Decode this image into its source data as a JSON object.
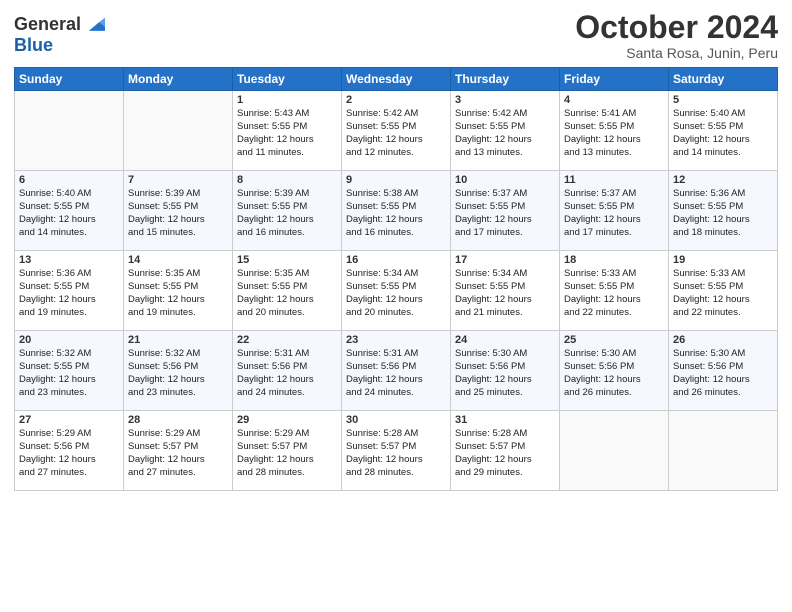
{
  "logo": {
    "line1": "General",
    "line2": "Blue"
  },
  "title": "October 2024",
  "location": "Santa Rosa, Junin, Peru",
  "days_header": [
    "Sunday",
    "Monday",
    "Tuesday",
    "Wednesday",
    "Thursday",
    "Friday",
    "Saturday"
  ],
  "weeks": [
    [
      {
        "num": "",
        "info": ""
      },
      {
        "num": "",
        "info": ""
      },
      {
        "num": "1",
        "info": "Sunrise: 5:43 AM\nSunset: 5:55 PM\nDaylight: 12 hours\nand 11 minutes."
      },
      {
        "num": "2",
        "info": "Sunrise: 5:42 AM\nSunset: 5:55 PM\nDaylight: 12 hours\nand 12 minutes."
      },
      {
        "num": "3",
        "info": "Sunrise: 5:42 AM\nSunset: 5:55 PM\nDaylight: 12 hours\nand 13 minutes."
      },
      {
        "num": "4",
        "info": "Sunrise: 5:41 AM\nSunset: 5:55 PM\nDaylight: 12 hours\nand 13 minutes."
      },
      {
        "num": "5",
        "info": "Sunrise: 5:40 AM\nSunset: 5:55 PM\nDaylight: 12 hours\nand 14 minutes."
      }
    ],
    [
      {
        "num": "6",
        "info": "Sunrise: 5:40 AM\nSunset: 5:55 PM\nDaylight: 12 hours\nand 14 minutes."
      },
      {
        "num": "7",
        "info": "Sunrise: 5:39 AM\nSunset: 5:55 PM\nDaylight: 12 hours\nand 15 minutes."
      },
      {
        "num": "8",
        "info": "Sunrise: 5:39 AM\nSunset: 5:55 PM\nDaylight: 12 hours\nand 16 minutes."
      },
      {
        "num": "9",
        "info": "Sunrise: 5:38 AM\nSunset: 5:55 PM\nDaylight: 12 hours\nand 16 minutes."
      },
      {
        "num": "10",
        "info": "Sunrise: 5:37 AM\nSunset: 5:55 PM\nDaylight: 12 hours\nand 17 minutes."
      },
      {
        "num": "11",
        "info": "Sunrise: 5:37 AM\nSunset: 5:55 PM\nDaylight: 12 hours\nand 17 minutes."
      },
      {
        "num": "12",
        "info": "Sunrise: 5:36 AM\nSunset: 5:55 PM\nDaylight: 12 hours\nand 18 minutes."
      }
    ],
    [
      {
        "num": "13",
        "info": "Sunrise: 5:36 AM\nSunset: 5:55 PM\nDaylight: 12 hours\nand 19 minutes."
      },
      {
        "num": "14",
        "info": "Sunrise: 5:35 AM\nSunset: 5:55 PM\nDaylight: 12 hours\nand 19 minutes."
      },
      {
        "num": "15",
        "info": "Sunrise: 5:35 AM\nSunset: 5:55 PM\nDaylight: 12 hours\nand 20 minutes."
      },
      {
        "num": "16",
        "info": "Sunrise: 5:34 AM\nSunset: 5:55 PM\nDaylight: 12 hours\nand 20 minutes."
      },
      {
        "num": "17",
        "info": "Sunrise: 5:34 AM\nSunset: 5:55 PM\nDaylight: 12 hours\nand 21 minutes."
      },
      {
        "num": "18",
        "info": "Sunrise: 5:33 AM\nSunset: 5:55 PM\nDaylight: 12 hours\nand 22 minutes."
      },
      {
        "num": "19",
        "info": "Sunrise: 5:33 AM\nSunset: 5:55 PM\nDaylight: 12 hours\nand 22 minutes."
      }
    ],
    [
      {
        "num": "20",
        "info": "Sunrise: 5:32 AM\nSunset: 5:55 PM\nDaylight: 12 hours\nand 23 minutes."
      },
      {
        "num": "21",
        "info": "Sunrise: 5:32 AM\nSunset: 5:56 PM\nDaylight: 12 hours\nand 23 minutes."
      },
      {
        "num": "22",
        "info": "Sunrise: 5:31 AM\nSunset: 5:56 PM\nDaylight: 12 hours\nand 24 minutes."
      },
      {
        "num": "23",
        "info": "Sunrise: 5:31 AM\nSunset: 5:56 PM\nDaylight: 12 hours\nand 24 minutes."
      },
      {
        "num": "24",
        "info": "Sunrise: 5:30 AM\nSunset: 5:56 PM\nDaylight: 12 hours\nand 25 minutes."
      },
      {
        "num": "25",
        "info": "Sunrise: 5:30 AM\nSunset: 5:56 PM\nDaylight: 12 hours\nand 26 minutes."
      },
      {
        "num": "26",
        "info": "Sunrise: 5:30 AM\nSunset: 5:56 PM\nDaylight: 12 hours\nand 26 minutes."
      }
    ],
    [
      {
        "num": "27",
        "info": "Sunrise: 5:29 AM\nSunset: 5:56 PM\nDaylight: 12 hours\nand 27 minutes."
      },
      {
        "num": "28",
        "info": "Sunrise: 5:29 AM\nSunset: 5:57 PM\nDaylight: 12 hours\nand 27 minutes."
      },
      {
        "num": "29",
        "info": "Sunrise: 5:29 AM\nSunset: 5:57 PM\nDaylight: 12 hours\nand 28 minutes."
      },
      {
        "num": "30",
        "info": "Sunrise: 5:28 AM\nSunset: 5:57 PM\nDaylight: 12 hours\nand 28 minutes."
      },
      {
        "num": "31",
        "info": "Sunrise: 5:28 AM\nSunset: 5:57 PM\nDaylight: 12 hours\nand 29 minutes."
      },
      {
        "num": "",
        "info": ""
      },
      {
        "num": "",
        "info": ""
      }
    ]
  ]
}
